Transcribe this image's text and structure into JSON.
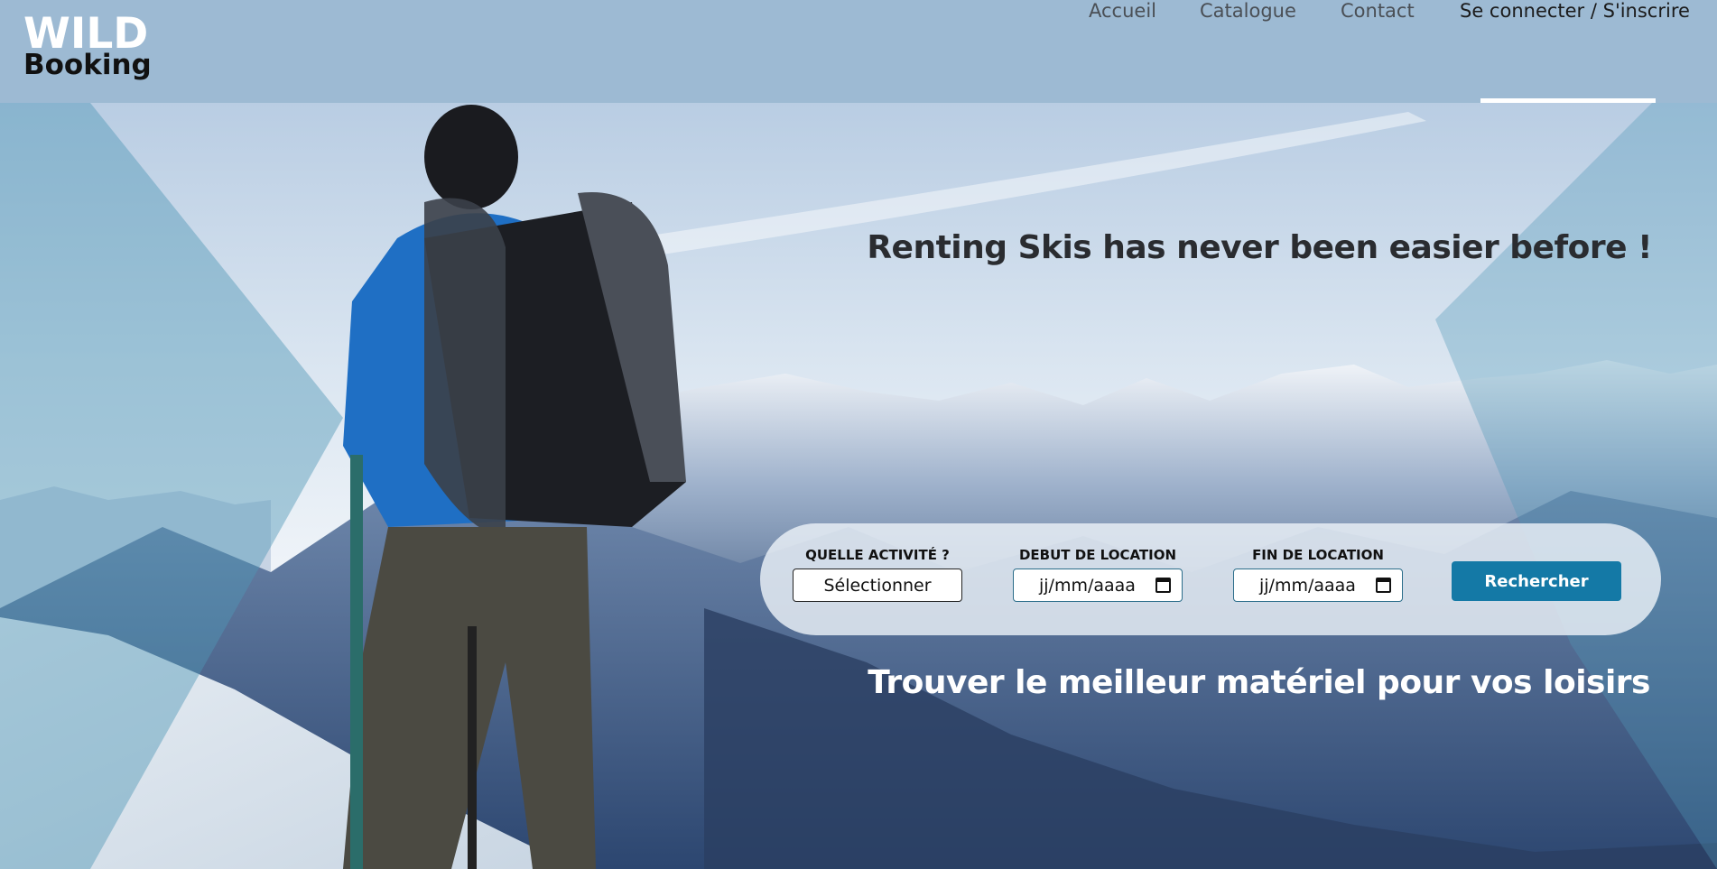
{
  "logo": {
    "line1": "WILD",
    "line2": "Booking"
  },
  "nav": {
    "items": [
      {
        "label": "Accueil"
      },
      {
        "label": "Catalogue"
      },
      {
        "label": "Contact"
      },
      {
        "label": "Se connecter / S'inscrire",
        "active": true
      }
    ]
  },
  "hero": {
    "title": "Renting Skis has never been easier before !",
    "subtitle": "Trouver le meilleur matériel pour vos loisirs"
  },
  "search": {
    "activity_label": "QUELLE ACTIVITÉ ?",
    "activity_value": "Sélectionner",
    "start_label": "DEBUT DE LOCATION",
    "start_value": "jj/mm/aaaa",
    "end_label": "FIN DE LOCATION",
    "end_value": "jj/mm/aaaa",
    "button_label": "Rechercher"
  },
  "colors": {
    "header_bg": "#9dbad3",
    "accent": "#1479a6",
    "active_underline": "#ffffff"
  }
}
